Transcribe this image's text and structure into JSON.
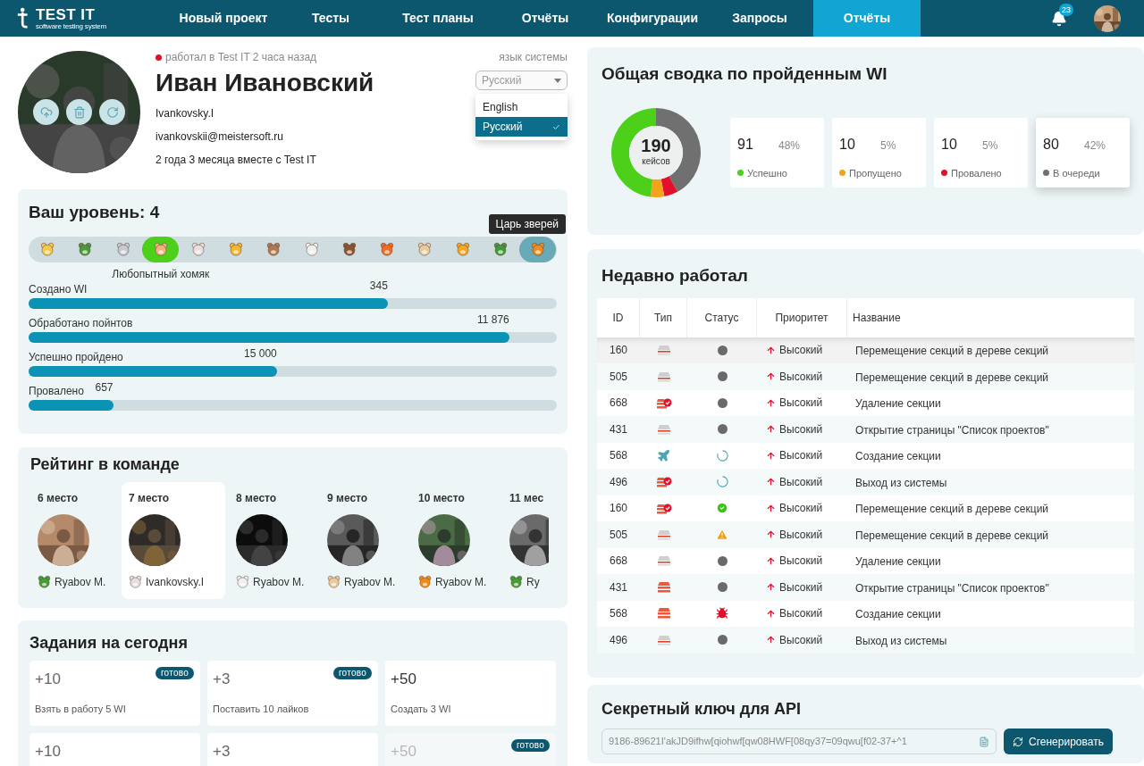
{
  "nav": {
    "logo": {
      "title": "TEST IT",
      "subtitle": "software testing system"
    },
    "items": [
      {
        "label": "Новый проект",
        "selected": false
      },
      {
        "label": "Тесты",
        "selected": false
      },
      {
        "label": "Тест планы",
        "selected": false
      },
      {
        "label": "Отчёты",
        "selected": false
      },
      {
        "label": "Конфигурации",
        "selected": false
      },
      {
        "label": "Запросы",
        "selected": false
      },
      {
        "label": "Отчёты",
        "selected": true
      }
    ],
    "notifications": "23"
  },
  "profile": {
    "online": false,
    "last_seen": "работал в Test IT 2 часа назад",
    "name": "Иван Ивановский",
    "login": "Ivankovsky.I",
    "email": "ivankovskii@meistersoft.ru",
    "tenure": "2 года 3 месяца вместе с Test IT",
    "language": {
      "label": "язык системы",
      "value": "Русский",
      "expanded": true,
      "options": [
        {
          "label": "English",
          "selected": false
        },
        {
          "label": "Русский",
          "selected": true
        }
      ]
    }
  },
  "level": {
    "title": "Ваш уровень: 4",
    "tooltip": "Царь зверей",
    "caption": "Любопытный хомяк",
    "steps": [
      {
        "selected": false,
        "hovered": false
      },
      {
        "selected": false,
        "hovered": false
      },
      {
        "selected": false,
        "hovered": false
      },
      {
        "selected": true,
        "hovered": false
      },
      {
        "selected": false,
        "hovered": false
      },
      {
        "selected": false,
        "hovered": false
      },
      {
        "selected": false,
        "hovered": false
      },
      {
        "selected": false,
        "hovered": false
      },
      {
        "selected": false,
        "hovered": false
      },
      {
        "selected": false,
        "hovered": false
      },
      {
        "selected": false,
        "hovered": false
      },
      {
        "selected": false,
        "hovered": false
      },
      {
        "selected": false,
        "hovered": false
      },
      {
        "selected": false,
        "hovered": true
      }
    ],
    "stats": [
      {
        "label": "Создано WI",
        "value": "345",
        "level": 0.68
      },
      {
        "label": "Обработано пойнтов",
        "value": "11 876",
        "level": 0.91
      },
      {
        "label": "Успешно пройдено",
        "value": "15 000",
        "level": 0.47
      },
      {
        "label": "Провалено",
        "value": "657",
        "level": 0.16
      }
    ]
  },
  "rating": {
    "title": "Рейтинг в команде",
    "members": [
      {
        "place": "6 место",
        "name": "Ryabov M.",
        "selected": false
      },
      {
        "place": "7 место",
        "name": "Ivankovsky.I",
        "selected": true
      },
      {
        "place": "8 место",
        "name": "Ryabov M.",
        "selected": false
      },
      {
        "place": "9 место",
        "name": "Ryabov M.",
        "selected": false
      },
      {
        "place": "10 место",
        "name": "Ryabov M.",
        "selected": false
      },
      {
        "place": "11 мес",
        "name": "Ry",
        "selected": false
      }
    ]
  },
  "tasks": {
    "title": "Задания на сегодня",
    "items": [
      {
        "points": "+10",
        "text": "Взять в работу 5 WI",
        "badge": "готово",
        "disabled": false
      },
      {
        "points": "+3",
        "text": "Поставить 10 лайков",
        "badge": "готово",
        "disabled": false
      },
      {
        "points": "+50",
        "text": "Создать 3 WI",
        "disabled": false
      },
      {
        "points": "+10",
        "disabled": false
      },
      {
        "points": "+3",
        "disabled": false
      },
      {
        "points": "+50",
        "badge": "готово",
        "disabled": true
      }
    ]
  },
  "summary": {
    "title": "Общая сводка по пройденным WI",
    "total": "190",
    "total_label": "кейсов",
    "chart_data": {
      "type": "donut",
      "values": [
        48,
        5,
        5,
        42
      ]
    },
    "stats": [
      {
        "value": "91",
        "percent": "48%",
        "label": "Успешно",
        "color": "#4cd01a",
        "selected": false
      },
      {
        "value": "10",
        "percent": "5%",
        "label": "Пропущено",
        "color": "#f7a21b",
        "selected": false
      },
      {
        "value": "10",
        "percent": "5%",
        "label": "Провалено",
        "color": "#e2102c",
        "selected": false
      },
      {
        "value": "80",
        "percent": "42%",
        "label": "В очереди",
        "color": "#707070",
        "selected": true
      }
    ]
  },
  "recent": {
    "title": "Недавно работал",
    "columns": [
      "ID",
      "Тип",
      "Статус",
      "Приоритет",
      "Название"
    ],
    "rows": [
      {
        "id": "160",
        "type": {
          "kind": "draft"
        },
        "status": {
          "kind": "none"
        },
        "priority": "Высокий",
        "name": "Перемещение секций в дереве секций",
        "selected": true
      },
      {
        "id": "505",
        "type": {
          "kind": "draft"
        },
        "status": {
          "kind": "none"
        },
        "priority": "Высокий",
        "name": "Перемещение секций в дереве секций",
        "selected": false
      },
      {
        "id": "668",
        "type": {
          "kind": "checked"
        },
        "status": {
          "kind": "none"
        },
        "priority": "Высокий",
        "name": "Удаление секции",
        "selected": false
      },
      {
        "id": "431",
        "type": {
          "kind": "draft"
        },
        "status": {
          "kind": "none"
        },
        "priority": "Высокий",
        "name": "Открытие страницы \"Список проектов\"",
        "selected": false
      },
      {
        "id": "568",
        "type": {
          "kind": "flight"
        },
        "status": {
          "kind": "progress"
        },
        "priority": "Высокий",
        "name": "Создание секции",
        "selected": false
      },
      {
        "id": "496",
        "type": {
          "kind": "checked"
        },
        "status": {
          "kind": "progress"
        },
        "priority": "Высокий",
        "name": "Выход из системы",
        "selected": false
      },
      {
        "id": "160",
        "type": {
          "kind": "checked"
        },
        "status": {
          "kind": "passed"
        },
        "priority": "Высокий",
        "name": "Перемещение секций в дереве секций",
        "selected": false
      },
      {
        "id": "505",
        "type": {
          "kind": "draft"
        },
        "status": {
          "kind": "warning"
        },
        "priority": "Высокий",
        "name": "Перемещение секций в дереве секций",
        "selected": false
      },
      {
        "id": "668",
        "type": {
          "kind": "draft"
        },
        "status": {
          "kind": "none"
        },
        "priority": "Высокий",
        "name": "Удаление секции",
        "selected": false
      },
      {
        "id": "431",
        "type": {
          "kind": "full"
        },
        "status": {
          "kind": "none"
        },
        "priority": "Высокий",
        "name": "Открытие страницы \"Список проектов\"",
        "selected": false
      },
      {
        "id": "568",
        "type": {
          "kind": "full"
        },
        "status": {
          "kind": "failed"
        },
        "priority": "Высокий",
        "name": "Создание секции",
        "selected": false
      },
      {
        "id": "496",
        "type": {
          "kind": "draft"
        },
        "status": {
          "kind": "none"
        },
        "priority": "Высокий",
        "name": "Выход из системы",
        "selected": false
      }
    ]
  },
  "api": {
    "title": "Секретный ключ для API",
    "key": "9186-89621I'akJD9ifhw[qiohwf[qw08HWF[08qy37=09qwu[f02-37+^1",
    "button": "Сгенерировать"
  }
}
